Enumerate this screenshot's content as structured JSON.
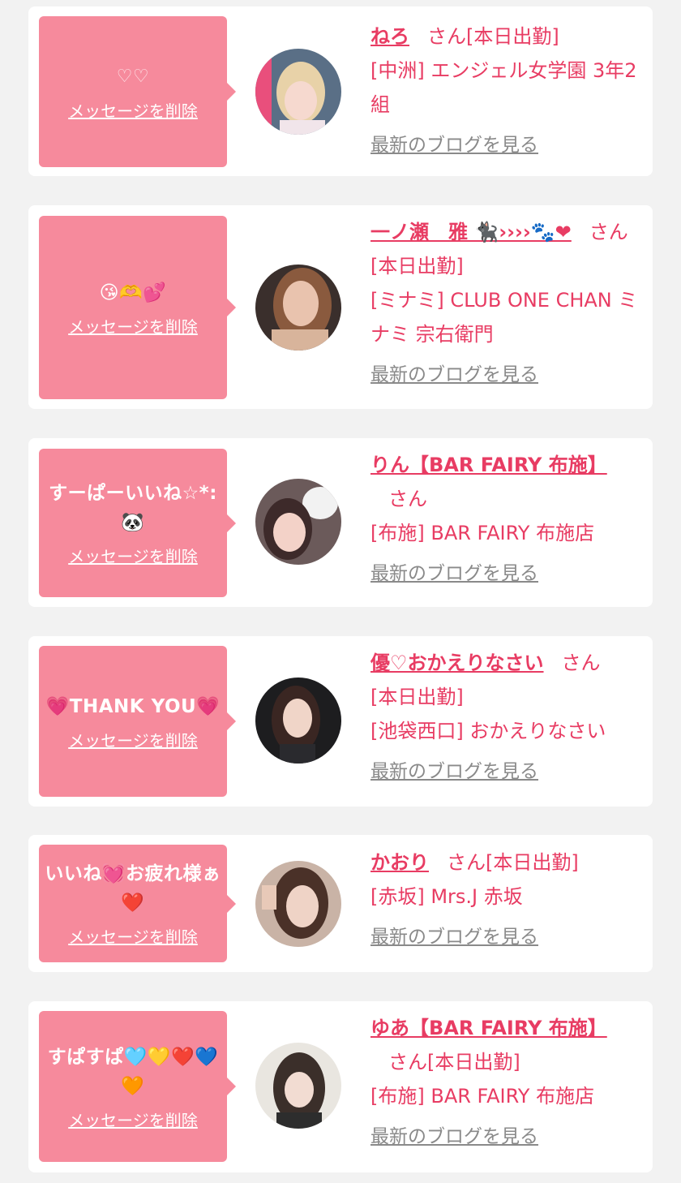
{
  "delete_label": "メッセージを削除",
  "blog_label": "最新のブログを見る",
  "san_label": "さん",
  "colors": {
    "background": "#f2f2f2",
    "card": "#ffffff",
    "bubble": "#f68a9c",
    "accent": "#e83c63",
    "link_gray": "#8a8a8a"
  },
  "cards": [
    {
      "message": "♡♡",
      "name": "ねろ",
      "status": "[本日出勤]",
      "shop": "[中洲] エンジェル女学園 3年2組"
    },
    {
      "message": "😘🫶💕",
      "name": "一ノ瀬　雅 🐈‍⬛››››🐾❤",
      "status": "[本日出勤]",
      "shop": "[ミナミ] CLUB ONE CHAN ミナミ 宗右衛門"
    },
    {
      "message": "すーぱーいいね☆*: 🐼",
      "name": "りん【BAR FAIRY 布施】",
      "status": "",
      "shop": "[布施] BAR FAIRY 布施店"
    },
    {
      "message": "💗THANK YOU💗",
      "name": "優♡おかえりなさい",
      "status": "[本日出勤]",
      "shop": "[池袋西口] おかえりなさい"
    },
    {
      "message": "いいね💓お疲れ様ぁ❤️",
      "name": "かおり",
      "status": "[本日出勤]",
      "shop": "[赤坂] Mrs.J 赤坂"
    },
    {
      "message": "すぱすぱ🩵💛❤️💙🧡",
      "name": "ゆあ【BAR FAIRY 布施】",
      "status": "[本日出勤]",
      "shop": "[布施] BAR FAIRY 布施店"
    }
  ]
}
